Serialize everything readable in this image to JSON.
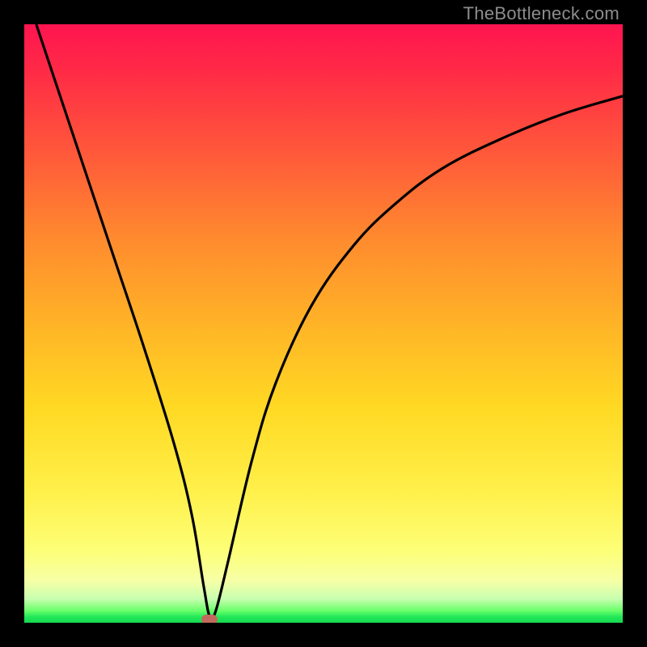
{
  "watermark": "TheBottleneck.com",
  "chart_data": {
    "type": "line",
    "title": "",
    "xlabel": "",
    "ylabel": "",
    "xlim": [
      0,
      100
    ],
    "ylim": [
      0,
      100
    ],
    "legend": false,
    "grid": false,
    "series": [
      {
        "name": "bottleneck-curve",
        "x": [
          2,
          5,
          10,
          15,
          20,
          25,
          28,
          30,
          31,
          32,
          34,
          38,
          42,
          48,
          55,
          62,
          70,
          80,
          90,
          100
        ],
        "values": [
          100,
          91,
          76,
          61,
          46,
          30,
          18,
          6,
          1,
          2,
          10,
          27,
          40,
          53,
          63,
          70,
          76,
          81,
          85,
          88
        ]
      }
    ],
    "annotations": [
      {
        "name": "min-marker",
        "x": 31,
        "y": 0.5,
        "color": "#c26a5e"
      }
    ],
    "background_gradient": {
      "top": "#ff1450",
      "mid": "#ffd923",
      "bottom": "#17d84f"
    }
  },
  "colors": {
    "curve": "#000000",
    "marker": "#c26a5e"
  }
}
